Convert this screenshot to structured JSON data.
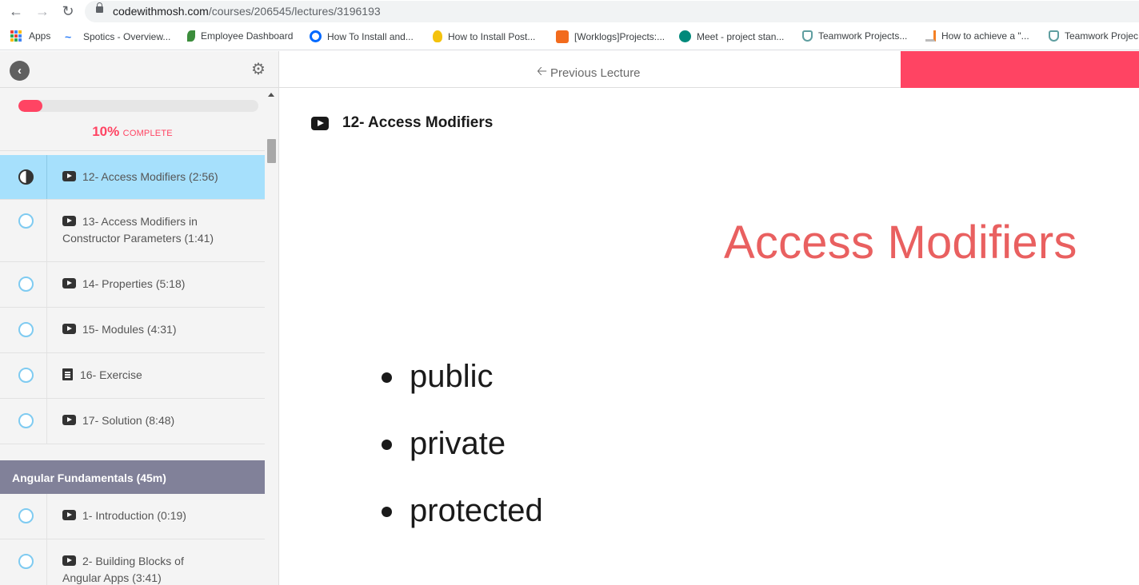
{
  "browser": {
    "url_host": "codewithmosh.com",
    "url_path": "/courses/206545/lectures/3196193",
    "bookmarks": [
      {
        "label": "Apps",
        "icon": "apps-grid-icon",
        "color": "#4285f4"
      },
      {
        "label": "Spotics - Overview...",
        "icon": "spotics-icon",
        "color": "#2d7ff9"
      },
      {
        "label": "Employee Dashboard",
        "icon": "leaf-icon",
        "color": "#3c8d3c"
      },
      {
        "label": "How To Install and...",
        "icon": "digitalocean-icon",
        "color": "#0069ff"
      },
      {
        "label": "How to Install Post...",
        "icon": "lightbulb-icon",
        "color": "#f4c20d"
      },
      {
        "label": "[Worklogs]Projects:...",
        "icon": "worklogs-icon",
        "color": "#f26b1d"
      },
      {
        "label": "Meet - project stan...",
        "icon": "meet-icon",
        "color": "#00897b"
      },
      {
        "label": "Teamwork Projects...",
        "icon": "teamwork-icon",
        "color": "#5f9ea0"
      },
      {
        "label": "How to achieve a \"...",
        "icon": "stackoverflow-icon",
        "color": "#f48024"
      },
      {
        "label": "Teamwork Projec",
        "icon": "teamwork-icon",
        "color": "#5f9ea0"
      }
    ]
  },
  "sidebar": {
    "progress_percent": 10,
    "progress_pct_label": "10%",
    "progress_complete_label": "COMPLETE",
    "lectures": [
      {
        "title": "12- Access Modifiers (2:56)",
        "type": "video",
        "active": true
      },
      {
        "title": "13- Access Modifiers in Constructor Parameters (1:41)",
        "type": "video",
        "active": false
      },
      {
        "title": "14- Properties (5:18)",
        "type": "video",
        "active": false
      },
      {
        "title": "15- Modules (4:31)",
        "type": "video",
        "active": false
      },
      {
        "title": "16- Exercise",
        "type": "document",
        "active": false
      },
      {
        "title": "17- Solution (8:48)",
        "type": "video",
        "active": false
      }
    ],
    "section_title": "Angular Fundamentals (45m)",
    "section_lectures": [
      {
        "title": "1- Introduction (0:19)",
        "type": "video",
        "active": false
      },
      {
        "title": "2- Building Blocks of Angular Apps (3:41)",
        "type": "video",
        "active": false
      }
    ]
  },
  "main": {
    "prev_label": "Previous Lecture",
    "lecture_title": "12- Access Modifiers",
    "slide_title": "Access Modifiers",
    "slide_bullets": [
      "public",
      "private",
      "protected"
    ]
  },
  "colors": {
    "accent": "#ff4463",
    "active_row": "#a6e0fc",
    "section_header": "#818199",
    "slide_title": "#e96060"
  }
}
